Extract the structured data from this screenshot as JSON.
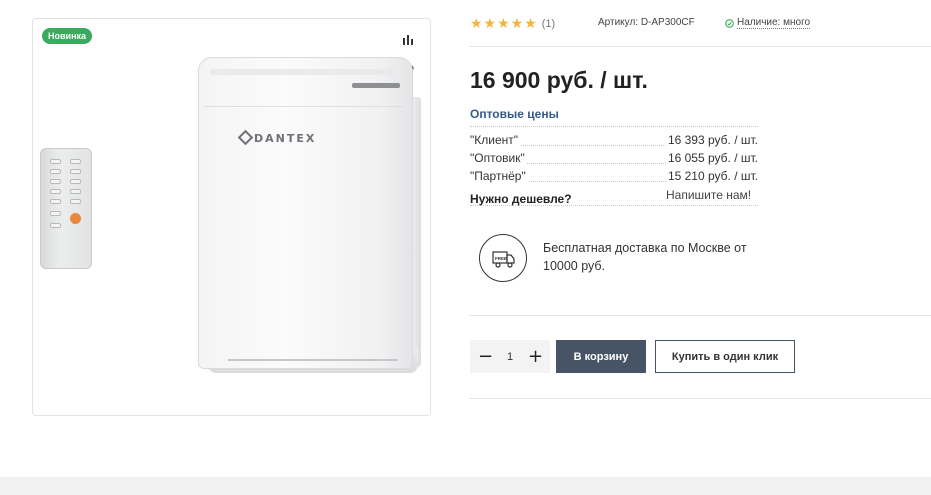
{
  "product": {
    "badge": "Новинка",
    "brand_logo": "DANTEX",
    "price": "16 900 руб. / шт."
  },
  "rating": {
    "stars": "★★★★★",
    "count": "(1)"
  },
  "article": "Артикул: D-AP300CF",
  "availability": "Наличие: много",
  "wholesale": {
    "title": "Оптовые цены",
    "rows": [
      {
        "name": "\"Клиент\"",
        "price": "16 393 руб. / шт."
      },
      {
        "name": "\"Оптовик\"",
        "price": "16 055 руб. / шт."
      },
      {
        "name": "\"Партнёр\"",
        "price": "15 210 руб. / шт."
      }
    ]
  },
  "cheaper": {
    "label": "Нужно дешевле?",
    "link": "Напишите нам!"
  },
  "delivery": {
    "text": "Бесплатная доставка по Москве от 10000 руб.",
    "icon": "delivery-truck-icon",
    "icon_label": "FREE"
  },
  "cart": {
    "minus": "−",
    "quantity": "1",
    "plus": "+",
    "add_label": "В корзину",
    "one_click_label": "Купить в один клик"
  },
  "colors": {
    "badge": "#3aaa5c",
    "stars": "#f2b63c",
    "wholesale_title": "#355a8a",
    "button": "#475466",
    "availability_check": "#3aaa5c"
  }
}
